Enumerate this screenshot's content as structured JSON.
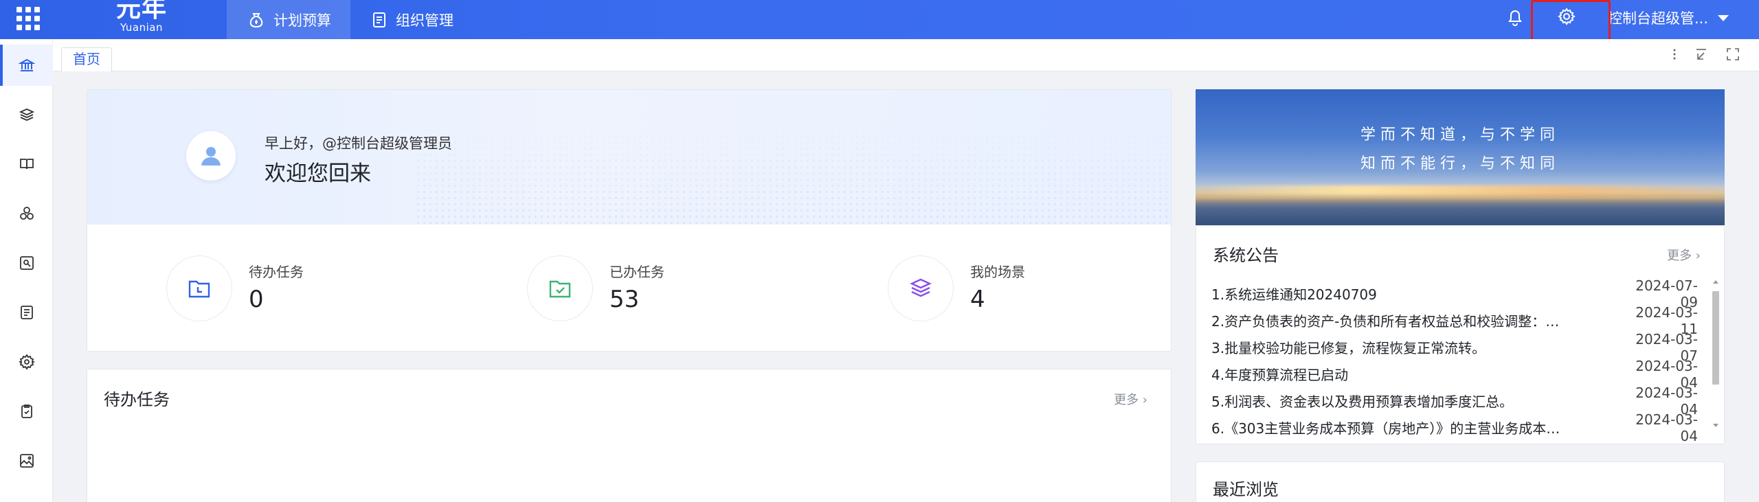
{
  "header": {
    "logo_cn": "元年",
    "logo_en": "Yuanian",
    "nav": [
      {
        "label": "计划预算",
        "icon": "money-bag-icon",
        "active": true
      },
      {
        "label": "组织管理",
        "icon": "document-icon",
        "active": false
      }
    ],
    "user_name": "控制台超级管...",
    "icons": [
      "apps-grid-icon",
      "bell-icon",
      "gear-icon",
      "caret-down-icon"
    ]
  },
  "sidebar": {
    "items": [
      {
        "icon": "bank-icon",
        "active": true
      },
      {
        "icon": "layers-icon"
      },
      {
        "icon": "open-book-icon"
      },
      {
        "icon": "cubes-icon"
      },
      {
        "icon": "image-search-icon"
      },
      {
        "icon": "list-doc-icon"
      },
      {
        "icon": "gear-icon"
      },
      {
        "icon": "clipboard-icon"
      },
      {
        "icon": "landscape-icon"
      }
    ]
  },
  "tabs": {
    "home": "首页"
  },
  "welcome": {
    "greeting": "早上好，@控制台超级管理员",
    "title": "欢迎您回来",
    "stats": [
      {
        "label": "待办任务",
        "value": "0",
        "color": "#2f62e6"
      },
      {
        "label": "已办任务",
        "value": "53",
        "color": "#3cb371"
      },
      {
        "label": "我的场景",
        "value": "4",
        "color": "#8a4bf0"
      }
    ]
  },
  "todo": {
    "title": "待办任务",
    "more": "更多 ›"
  },
  "banner": {
    "line1": "学而不知道，与不学同",
    "line2": "知而不能行，与不知同"
  },
  "notice": {
    "title": "系统公告",
    "more": "更多 ›",
    "items": [
      {
        "title": "1.系统运维通知20240709",
        "date": "2024-07-09"
      },
      {
        "title": "2.资产负债表的资产-负债和所有者权益总和校验调整：…",
        "date": "2024-03-11"
      },
      {
        "title": "3.批量校验功能已修复，流程恢复正常流转。",
        "date": "2024-03-07"
      },
      {
        "title": "4.年度预算流程已启动",
        "date": "2024-03-04"
      },
      {
        "title": "5.利润表、资金表以及费用预算表增加季度汇总。",
        "date": "2024-03-04"
      },
      {
        "title": "6.《303主营业务成本预算（房地产）》的主营业务成本…",
        "date": "2024-03-04"
      }
    ]
  },
  "recent": {
    "title": "最近浏览"
  },
  "colors": {
    "primary": "#2f62e6",
    "highlight_box": "#e02020"
  }
}
